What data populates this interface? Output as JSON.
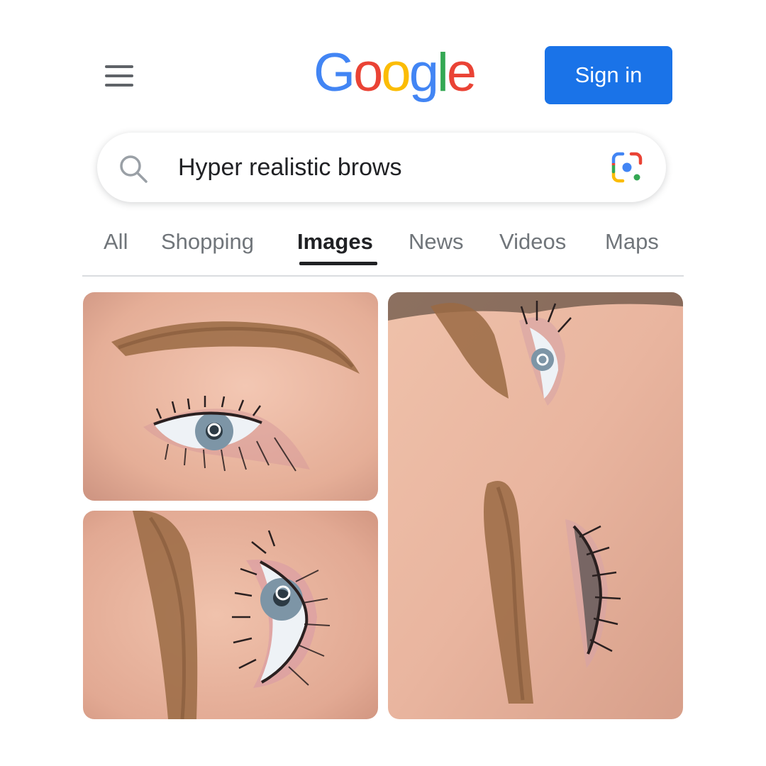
{
  "header": {
    "menu_icon": "hamburger-menu-icon",
    "logo_letters": [
      "G",
      "o",
      "o",
      "g",
      "l",
      "e"
    ],
    "logo_colors": [
      "#4285F4",
      "#EA4335",
      "#FBBC05",
      "#4285F4",
      "#34A853",
      "#EA4335"
    ],
    "signin_label": "Sign in"
  },
  "search": {
    "query": "Hyper realistic brows",
    "search_icon": "search-icon",
    "lens_icon": "google-lens-icon"
  },
  "tabs": [
    {
      "label": "All",
      "active": false
    },
    {
      "label": "Shopping",
      "active": false
    },
    {
      "label": "Images",
      "active": true
    },
    {
      "label": "News",
      "active": false
    },
    {
      "label": "Videos",
      "active": false
    },
    {
      "label": "Maps",
      "active": false
    }
  ],
  "colors": {
    "accent": "#1a73e8",
    "tab_inactive": "#70757a",
    "tab_active": "#202124",
    "skin": "#e9b8a2",
    "brow": "#9a6a43"
  }
}
